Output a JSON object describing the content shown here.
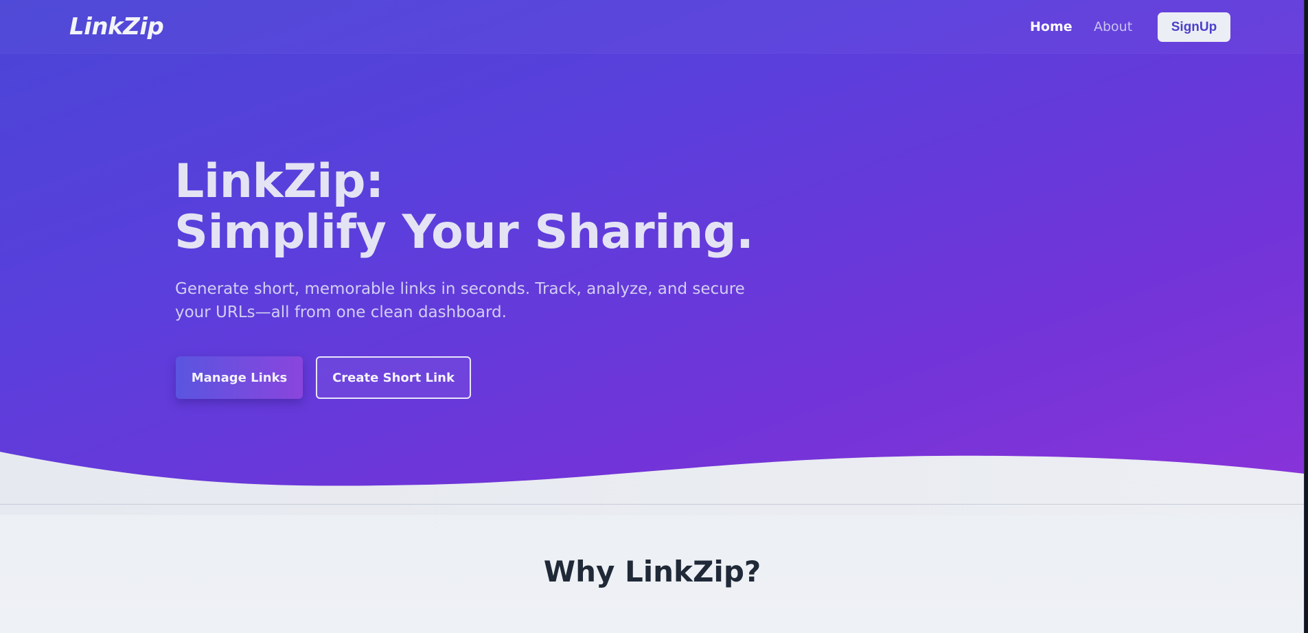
{
  "nav": {
    "logo": "LinkZip",
    "home": "Home",
    "about": "About",
    "signup": "SignUp"
  },
  "hero": {
    "title_line1": "LinkZip:",
    "title_line2": "Simplify Your Sharing.",
    "subtitle": "Generate short, memorable links in seconds. Track, analyze, and secure your URLs—all from one clean dashboard.",
    "primary_button": "Manage Links",
    "secondary_button": "Create Short Link"
  },
  "features": {
    "title": "Why LinkZip?"
  },
  "colors": {
    "hero_gradient_start": "#4a45d6",
    "hero_gradient_end": "#8a33d9",
    "accent": "#4b40c9",
    "section_bg": "#eef1f5",
    "title_text": "#1f2937"
  }
}
